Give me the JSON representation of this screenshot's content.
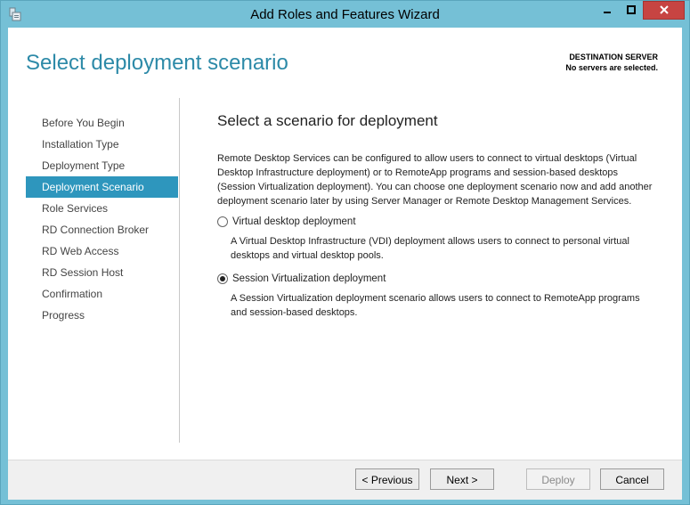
{
  "window": {
    "title": "Add Roles and Features Wizard",
    "close_color": "#c74442",
    "accent": "#2e96bd"
  },
  "header": {
    "page_title": "Select deployment scenario",
    "destination_label": "DESTINATION SERVER",
    "destination_value": "No servers are selected."
  },
  "nav": {
    "items": [
      {
        "label": "Before You Begin"
      },
      {
        "label": "Installation Type"
      },
      {
        "label": "Deployment Type"
      },
      {
        "label": "Deployment Scenario"
      },
      {
        "label": "Role Services"
      },
      {
        "label": "RD Connection Broker"
      },
      {
        "label": "RD Web Access"
      },
      {
        "label": "RD Session Host"
      },
      {
        "label": "Confirmation"
      },
      {
        "label": "Progress"
      }
    ],
    "active_index": 3
  },
  "main": {
    "heading": "Select a scenario for deployment",
    "description": "Remote Desktop Services can be configured to allow users to connect to virtual desktops (Virtual Desktop Infrastructure deployment) or to RemoteApp programs and session-based desktops (Session Virtualization deployment). You can choose one deployment scenario now and add another deployment scenario later by using Server Manager or Remote Desktop Management Services.",
    "options": [
      {
        "label": "Virtual desktop deployment",
        "description": "A Virtual Desktop Infrastructure (VDI) deployment allows users to connect to personal virtual desktops and virtual desktop pools.",
        "selected": false
      },
      {
        "label": "Session Virtualization deployment",
        "description": "A Session Virtualization deployment scenario allows users to connect to RemoteApp programs and session-based desktops.",
        "selected": true
      }
    ]
  },
  "footer": {
    "previous_label": "< Previous",
    "next_label": "Next >",
    "deploy_label": "Deploy",
    "cancel_label": "Cancel"
  },
  "icons": {
    "app": "server-wizard-icon",
    "minimize": "minimize-icon",
    "maximize": "maximize-icon",
    "close": "close-icon"
  }
}
